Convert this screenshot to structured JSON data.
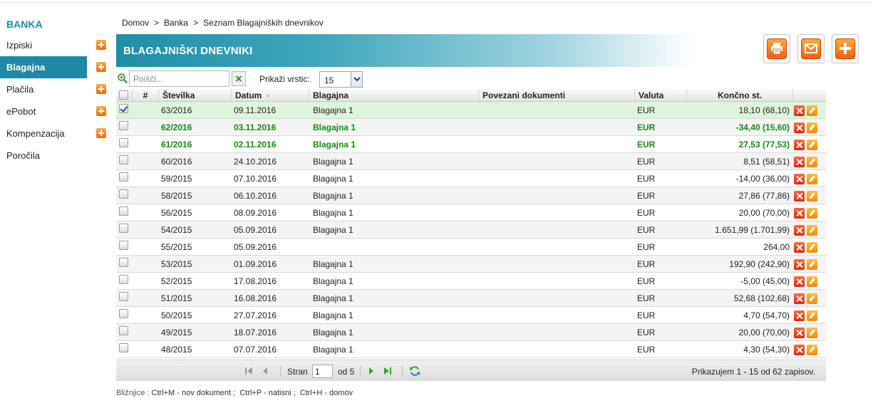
{
  "sidebar": {
    "brand": "BANKA",
    "items": [
      {
        "label": "Izpiski",
        "plus": true,
        "active": false
      },
      {
        "label": "Blagajna",
        "plus": true,
        "active": true
      },
      {
        "label": "Plačila",
        "plus": true,
        "active": false
      },
      {
        "label": "ePobot",
        "plus": true,
        "active": false
      },
      {
        "label": "Kompenzacija",
        "plus": true,
        "active": false
      },
      {
        "label": "Poročila",
        "plus": false,
        "active": false
      }
    ]
  },
  "breadcrumb": [
    "Domov",
    "Banka",
    "Seznam Blagajniških dnevnikov"
  ],
  "breadcrumb_sep": ">",
  "header": {
    "title": "BLAGAJNIŠKI DNEVNIKI"
  },
  "toolbar_buttons": [
    {
      "name": "print-button",
      "icon": "printer-icon"
    },
    {
      "name": "email-button",
      "icon": "envelope-icon"
    },
    {
      "name": "add-button",
      "icon": "plus-icon"
    }
  ],
  "search": {
    "placeholder": "Poišči...",
    "value": ""
  },
  "rows_per_page": {
    "label": "Prikaži vrstic:",
    "value": "15"
  },
  "table": {
    "columns": [
      "#",
      "Številka",
      "Datum",
      "Blagajna",
      "Povezani dokumenti",
      "Valuta",
      "Končno st."
    ],
    "rows": [
      {
        "stevilka": "63/2016",
        "datum": "09.11.2016",
        "blagajna": "Blagajna 1",
        "povezani": "",
        "valuta": "EUR",
        "koncno": "18,10 (68,10)",
        "checked": true,
        "green": false
      },
      {
        "stevilka": "62/2016",
        "datum": "03.11.2016",
        "blagajna": "Blagajna 1",
        "povezani": "",
        "valuta": "EUR",
        "koncno": "-34,40 (15,60)",
        "checked": false,
        "green": true
      },
      {
        "stevilka": "61/2016",
        "datum": "02.11.2016",
        "blagajna": "Blagajna 1",
        "povezani": "",
        "valuta": "EUR",
        "koncno": "27,53 (77,53)",
        "checked": false,
        "green": true
      },
      {
        "stevilka": "60/2016",
        "datum": "24.10.2016",
        "blagajna": "Blagajna 1",
        "povezani": "",
        "valuta": "EUR",
        "koncno": "8,51 (58,51)",
        "checked": false,
        "green": false
      },
      {
        "stevilka": "59/2015",
        "datum": "07.10.2016",
        "blagajna": "Blagajna 1",
        "povezani": "",
        "valuta": "EUR",
        "koncno": "-14,00 (36,00)",
        "checked": false,
        "green": false
      },
      {
        "stevilka": "58/2015",
        "datum": "06.10.2016",
        "blagajna": "Blagajna 1",
        "povezani": "",
        "valuta": "EUR",
        "koncno": "27,86 (77,86)",
        "checked": false,
        "green": false
      },
      {
        "stevilka": "56/2015",
        "datum": "08.09.2016",
        "blagajna": "Blagajna 1",
        "povezani": "",
        "valuta": "EUR",
        "koncno": "20,00 (70,00)",
        "checked": false,
        "green": false
      },
      {
        "stevilka": "54/2015",
        "datum": "05.09.2016",
        "blagajna": "Blagajna 1",
        "povezani": "",
        "valuta": "EUR",
        "koncno": "1.651,99 (1.701,99)",
        "checked": false,
        "green": false
      },
      {
        "stevilka": "55/2015",
        "datum": "05.09.2016",
        "blagajna": "",
        "povezani": "",
        "valuta": "EUR",
        "koncno": "264,00",
        "checked": false,
        "green": false
      },
      {
        "stevilka": "53/2015",
        "datum": "01.09.2016",
        "blagajna": "Blagajna 1",
        "povezani": "",
        "valuta": "EUR",
        "koncno": "192,90 (242,90)",
        "checked": false,
        "green": false
      },
      {
        "stevilka": "52/2015",
        "datum": "17.08.2016",
        "blagajna": "Blagajna 1",
        "povezani": "",
        "valuta": "EUR",
        "koncno": "-5,00 (45,00)",
        "checked": false,
        "green": false
      },
      {
        "stevilka": "51/2015",
        "datum": "16.08.2016",
        "blagajna": "Blagajna 1",
        "povezani": "",
        "valuta": "EUR",
        "koncno": "52,68 (102,68)",
        "checked": false,
        "green": false
      },
      {
        "stevilka": "50/2015",
        "datum": "27.07.2016",
        "blagajna": "Blagajna 1",
        "povezani": "",
        "valuta": "EUR",
        "koncno": "4,70 (54,70)",
        "checked": false,
        "green": false
      },
      {
        "stevilka": "49/2015",
        "datum": "18.07.2016",
        "blagajna": "Blagajna 1",
        "povezani": "",
        "valuta": "EUR",
        "koncno": "20,00 (70,00)",
        "checked": false,
        "green": false
      },
      {
        "stevilka": "48/2015",
        "datum": "07.07.2016",
        "blagajna": "Blagajna 1",
        "povezani": "",
        "valuta": "EUR",
        "koncno": "4,30 (54,30)",
        "checked": false,
        "green": false
      }
    ]
  },
  "pager": {
    "page_label": "Stran",
    "page_value": "1",
    "of_label": "od 5",
    "info": "Prikazujem 1 - 15 od 62 zapisov."
  },
  "shortcuts": {
    "label": "Bližnjice :",
    "text": "Ctrl+M - nov dokument ;  Ctrl+P - natisni ;  Ctrl+H - domov"
  },
  "colors": {
    "accent": "#1e88a6",
    "green_text": "#118c11",
    "selected_row": "#ddf5dd",
    "orange": "#f07a14"
  }
}
